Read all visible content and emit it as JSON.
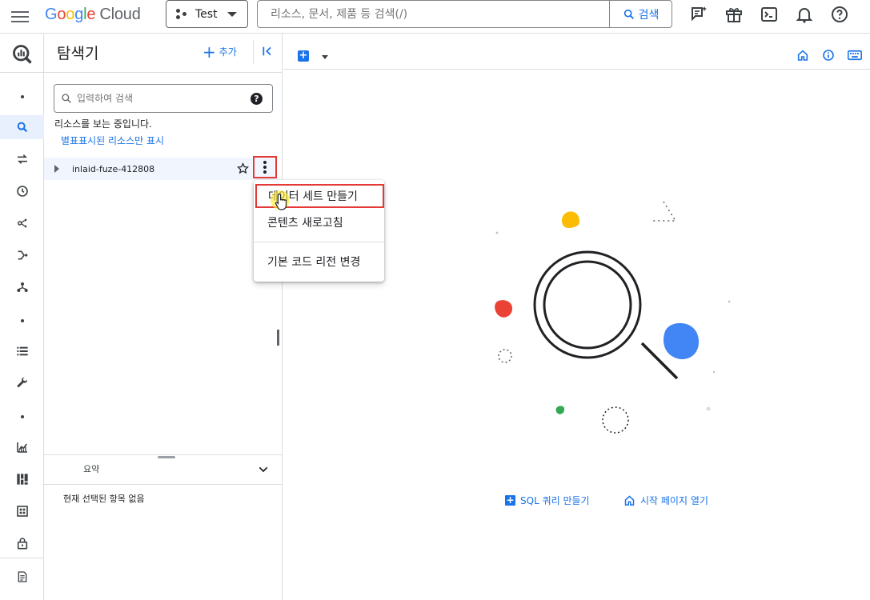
{
  "brand": {
    "google": "Google",
    "cloud": "Cloud"
  },
  "project": {
    "name": "Test"
  },
  "search": {
    "placeholder": "리소스, 문서, 제품 등 검색(/)",
    "button_label": "검색"
  },
  "explorer": {
    "title": "탐색기",
    "add_label": "추가",
    "search_placeholder": "입력하여 검색",
    "info_text": "리소스를 보는 중입니다.",
    "starred_only_link": "별표표시된 리소스만 표시",
    "project_id": "inlaid-fuze-412808"
  },
  "context_menu": {
    "items": [
      {
        "label": "데이터 세트 만들기"
      },
      {
        "label": "콘텐츠 새로고침"
      },
      {
        "label": "기본 코드 리전 변경"
      }
    ]
  },
  "summary": {
    "title": "요약",
    "empty_text": "현재 선택된 항목 없음"
  },
  "main": {
    "add_button_symbol": "+",
    "sql_query_link": "SQL 쿼리 만들기",
    "home_link": "시작 페이지 열기"
  },
  "colors": {
    "accent": "#1a73e8",
    "highlight_border": "#e53935",
    "selected_row": "#f1f5fd"
  },
  "icons": {
    "rail": [
      "bigquery-logo-icon",
      "dot-icon",
      "search-icon",
      "transfer-icon",
      "history-icon",
      "analytics-hub-icon",
      "dataflow-icon",
      "workflows-icon",
      "dot-icon",
      "list-icon",
      "wrench-icon",
      "dot-icon",
      "monitoring-icon",
      "dashboard-icon",
      "capacity-icon",
      "lock-icon",
      "release-notes-icon"
    ]
  }
}
